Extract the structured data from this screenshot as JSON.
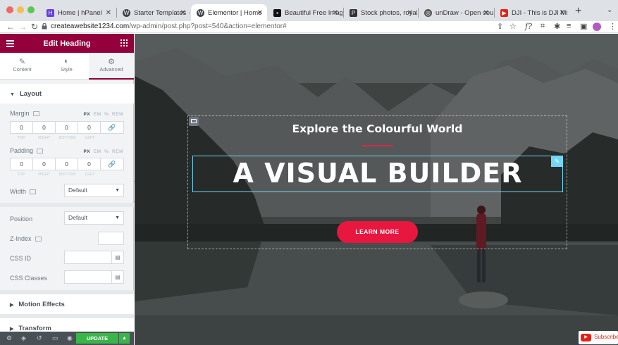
{
  "browser": {
    "tabs": [
      {
        "title": "Home | hPanel",
        "favicon": "hostinger-icon",
        "active": false
      },
      {
        "title": "Starter Templates ·",
        "favicon": "wordpress-icon",
        "active": false
      },
      {
        "title": "Elementor | Home",
        "favicon": "wordpress-icon",
        "active": true
      },
      {
        "title": "Beautiful Free Imag",
        "favicon": "unsplash-icon",
        "active": false
      },
      {
        "title": "Stock photos, royal",
        "favicon": "pexels-icon",
        "active": false
      },
      {
        "title": "unDraw - Open sou",
        "favicon": "undraw-icon",
        "active": false
      },
      {
        "title": "DJI - This is DJI Mi",
        "favicon": "youtube-icon",
        "active": false
      }
    ],
    "new_tab": "+",
    "url_host": "createawebsite1234.com",
    "url_path": "/wp-admin/post.php?post=540&action=elementor#"
  },
  "panel": {
    "title": "Edit Heading",
    "tabs": [
      {
        "label": "Content",
        "icon": "pencil-icon"
      },
      {
        "label": "Style",
        "icon": "half-circle-icon"
      },
      {
        "label": "Advanced",
        "icon": "gear-icon",
        "active": true
      }
    ],
    "layout_section": "Layout",
    "margin": {
      "label": "Margin",
      "units": [
        "PX",
        "EM",
        "%",
        "REM"
      ],
      "values": [
        "0",
        "0",
        "0",
        "0"
      ],
      "sub_labels": [
        "TOP",
        "RIGHT",
        "BOTTOM",
        "LEFT"
      ]
    },
    "padding": {
      "label": "Padding",
      "units": [
        "PX",
        "EM",
        "%",
        "REM"
      ],
      "values": [
        "0",
        "0",
        "0",
        "0"
      ],
      "sub_labels": [
        "TOP",
        "RIGHT",
        "BOTTOM",
        "LEFT"
      ]
    },
    "width": {
      "label": "Width",
      "value": "Default"
    },
    "position": {
      "label": "Position",
      "value": "Default"
    },
    "z_index": {
      "label": "Z-Index",
      "value": ""
    },
    "css_id": {
      "label": "CSS ID",
      "value": ""
    },
    "css_classes": {
      "label": "CSS Classes",
      "value": ""
    },
    "motion_effects": "Motion Effects",
    "transform": "Transform",
    "update_label": "UPDATE"
  },
  "canvas": {
    "subtitle": "Explore the Colourful World",
    "heading": "A VISUAL BUILDER",
    "button_label": "LEARN MORE",
    "youtube_label": "Subscribe",
    "colors": {
      "accent": "#e8173f",
      "panel_header": "#93003c",
      "selection": "#71d7f7",
      "update_green": "#39b54a"
    }
  }
}
